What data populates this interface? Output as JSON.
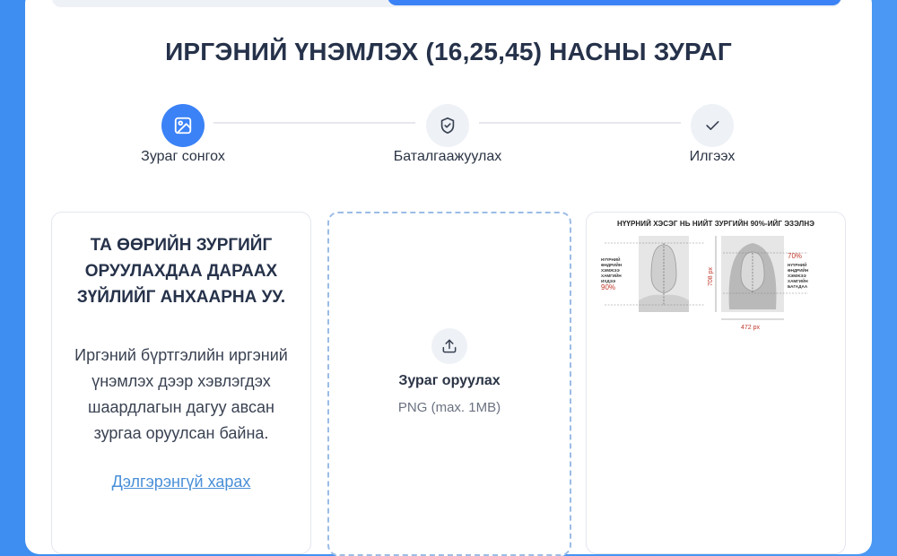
{
  "page": {
    "title": "ИРГЭНИЙ ҮНЭМЛЭХ (16,25,45) НАСНЫ ЗУРАГ"
  },
  "steps": [
    {
      "label": "Зураг сонгох",
      "icon": "image-icon",
      "active": true
    },
    {
      "label": "Баталгаажуулах",
      "icon": "shield-check-icon",
      "active": false
    },
    {
      "label": "Илгээх",
      "icon": "check-icon",
      "active": false
    }
  ],
  "info": {
    "heading": "ТА ӨӨРИЙН ЗУРГИЙГ ОРУУЛАХДАА ДАРААХ ЗҮЙЛИЙГ АНХААРНА УУ.",
    "text": "Иргэний бүртгэлийн иргэний үнэмлэх дээр хэвлэгдэх шаардлагын дагуу авсан зургаа оруулсан байна.",
    "link": "Дэлгэрэнгүй харах"
  },
  "upload": {
    "icon": "upload-icon",
    "title": "Зураг оруулах",
    "hint": "PNG (max. 1MB)"
  },
  "sample": {
    "title": "НҮҮРНИЙ ХЭСЭГ НЬ НИЙТ ЗУРГИЙН 90%-ИЙГ ЭЗЭЛНЭ",
    "left_caption": [
      "НҮҮРНИЙ",
      "ӨНДРИЙН",
      "ХЭМЖЭЭ",
      "ХАМГИЙН",
      "ИХДЭЭ"
    ],
    "left_percent": "90%",
    "right_percent": "70%",
    "right_caption": [
      "НҮҮРНИЙ",
      "ӨНДРИЙН",
      "ХЭМЖЭЭ",
      "ХАМГИЙН",
      "БАГАДАА"
    ],
    "height_label": "708 px",
    "width_label": "472 px",
    "accent": "#c0392b"
  },
  "colors": {
    "accent": "#3b82f6",
    "background": "#4a98f3",
    "link": "#4a8fd8"
  }
}
